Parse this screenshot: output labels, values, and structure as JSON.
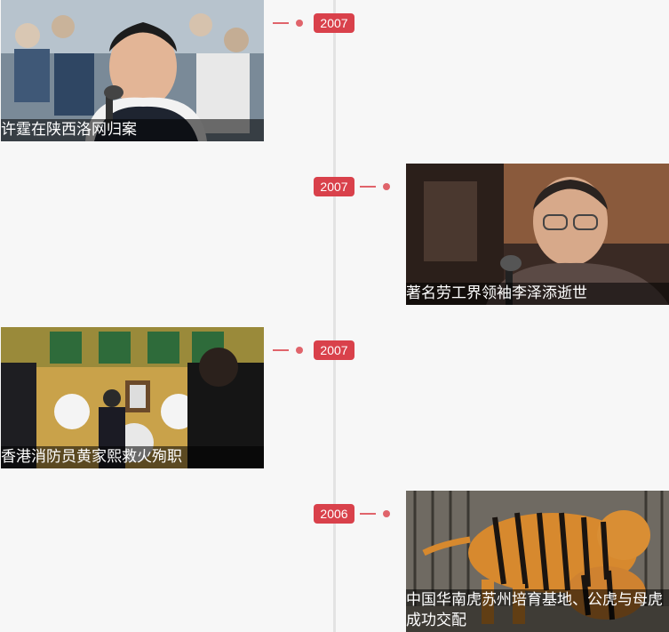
{
  "colors": {
    "accent": "#d9414b",
    "connector": "#e0646b",
    "axis": "#e3e3e3",
    "background": "#f7f7f7"
  },
  "timeline": {
    "items": [
      {
        "year": "2007",
        "caption": "许霆在陕西洛网归案",
        "side": "left",
        "image": "courtroom-photo"
      },
      {
        "year": "2007",
        "caption": "著名劳工界领袖李泽添逝世",
        "side": "right",
        "image": "elderly-man-photo"
      },
      {
        "year": "2007",
        "caption": "香港消防员黄家熙救火殉职",
        "side": "left",
        "image": "memorial-hall-photo"
      },
      {
        "year": "2006",
        "caption": "中国华南虎苏州培育基地、公虎与母虎成功交配",
        "side": "right",
        "image": "tigers-photo"
      }
    ]
  }
}
